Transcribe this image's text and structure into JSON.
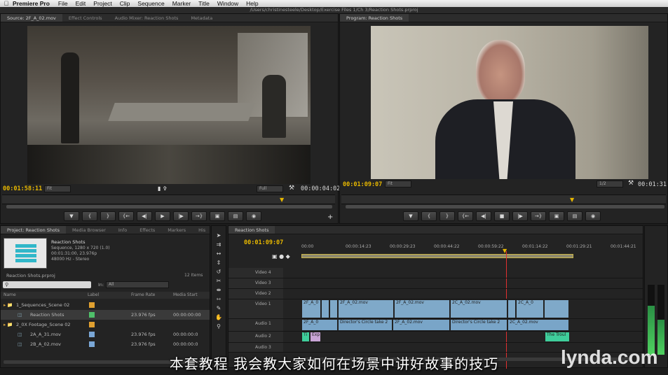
{
  "menubar": {
    "app": "Premiere Pro",
    "items": [
      "File",
      "Edit",
      "Project",
      "Clip",
      "Sequence",
      "Marker",
      "Title",
      "Window",
      "Help"
    ]
  },
  "titlebar": {
    "path": "/Users/christinesteele/Desktop/Exercise Files 1/Ch 3/Reaction Shots.prproj"
  },
  "source": {
    "tabs": [
      "Source: 2F_A_02.mov",
      "Effect Controls",
      "Audio Mixer: Reaction Shots",
      "Metadata"
    ],
    "timecode": "00:01:58:11",
    "fit": "Fit",
    "quality": "Full",
    "duration": "00:00:04:02"
  },
  "program": {
    "tabs": [
      "Program: Reaction Shots"
    ],
    "timecode": "00:01:09:07",
    "fit": "Fit",
    "quality": "1/2",
    "duration": "00:01:31:0"
  },
  "project": {
    "tabs": [
      "Project: Reaction Shots",
      "Media Browser",
      "Info",
      "Effects",
      "Markers",
      "His"
    ],
    "seq_name": "Reaction Shots",
    "seq_info1": "Sequence, 1280 x 720 (1.0)",
    "seq_info2": "00:01:31:00, 23.976p",
    "seq_info3": "48000 Hz - Stereo",
    "file": "Reaction Shots.prproj",
    "items_count": "12 Items",
    "in_label": "In:",
    "in_value": "All",
    "columns": [
      "Name",
      "Label",
      "Frame Rate",
      "Media Start"
    ],
    "rows": [
      {
        "name": "1_Sequences_Scene 02",
        "rate": "",
        "start": "",
        "label_color": "#e0a030"
      },
      {
        "name": "Reaction Shots",
        "rate": "23.976 fps",
        "start": "00:00:00:00",
        "label_color": "#4fc06a"
      },
      {
        "name": "2_0X Footage_Scene 02",
        "rate": "",
        "start": "",
        "label_color": "#e0a030"
      },
      {
        "name": "2A_A_31.mov",
        "rate": "23.976 fps",
        "start": "00:00:00:0",
        "label_color": "#7aa7d6"
      },
      {
        "name": "2B_A_02.mov",
        "rate": "23.976 fps",
        "start": "00:00:00:0",
        "label_color": "#7aa7d6"
      }
    ]
  },
  "timeline": {
    "tab": "Reaction Shots",
    "timecode": "00:01:09:07",
    "ruler": [
      "00:00",
      "00:00:14:23",
      "00:00:29:23",
      "00:00:44:22",
      "00:00:59:22",
      "00:01:14:22",
      "00:01:29:21",
      "00:01:44:21"
    ],
    "tracks": {
      "v4": "Video 4",
      "v3": "Video 3",
      "v2": "Video 2",
      "v1": "Video 1",
      "a1": "Audio 1",
      "a2": "Audio 2",
      "a3": "Audio 3",
      "vtag": "V",
      "atag": "A1"
    },
    "clips": {
      "v1a": "2F_A_0",
      "v1b": "2F_A_02.mov",
      "v1c": "2C_A_02.mov",
      "v1d": "2C_A_0",
      "aa": "2F_A_0",
      "ab": "2F_A_02.mov",
      "ac": "2C_A_02.mov",
      "g1": "Ti",
      "g2": "Exp",
      "g3": "The Troul",
      "fx1": "Director's Circle take 2",
      "fx2": "Director's Circle take 2",
      "fx3": "Director's Circle take 2",
      "fx4": "Director's Circle take 2"
    }
  },
  "subtitle": "本套教程  我会教大家如何在场景中讲好故事的技巧",
  "watermark": "lynda.com"
}
